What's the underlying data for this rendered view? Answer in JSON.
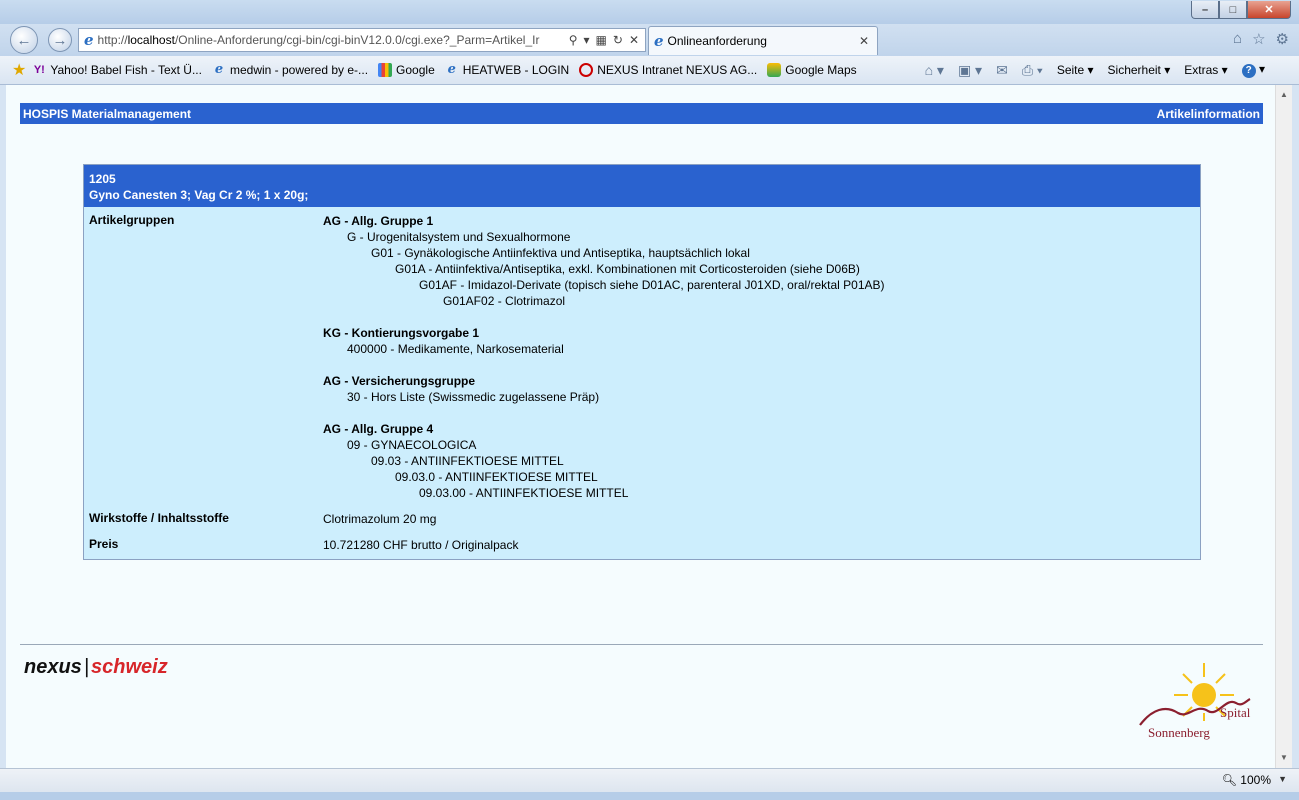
{
  "window": {
    "minimize": "–",
    "maximize": "□",
    "close": "✕"
  },
  "nav": {
    "url_prefix": "http://",
    "url_host": "localhost",
    "url_rest": "/Online-Anforderung/cgi-bin/cgi-binV12.0.0/cgi.exe?_Parm=Artikel_Ir",
    "tab_title": "Onlineanforderung"
  },
  "favorites": [
    "Yahoo! Babel Fish - Text Ü...",
    "medwin - powered by e-...",
    "Google",
    "HEATWEB - LOGIN",
    "NEXUS Intranet NEXUS AG...",
    "Google Maps"
  ],
  "commands": {
    "seite": "Seite",
    "sicherheit": "Sicherheit",
    "extras": "Extras"
  },
  "header": {
    "left": "HOSPIS Materialmanagement",
    "right": "Artikelinformation"
  },
  "article": {
    "number": "1205",
    "name": "Gyno Canesten 3; Vag Cr 2 %; 1 x 20g;",
    "labels": {
      "groups": "Artikelgruppen",
      "substances": "Wirkstoffe / Inhaltsstoffe",
      "price": "Preis"
    },
    "groups": [
      {
        "title": "AG - Allg. Gruppe 1",
        "items": [
          "G - Urogenitalsystem und Sexualhormone",
          "G01 - Gynäkologische Antiinfektiva und Antiseptika, hauptsächlich lokal",
          "G01A - Antiinfektiva/Antiseptika, exkl. Kombinationen mit Corticosteroiden (siehe D06B)",
          "G01AF - Imidazol-Derivate (topisch siehe D01AC, parenteral J01XD, oral/rektal P01AB)",
          "G01AF02 - Clotrimazol"
        ]
      },
      {
        "title": "KG - Kontierungsvorgabe 1",
        "items": [
          "400000 - Medikamente, Narkosematerial"
        ]
      },
      {
        "title": "AG - Versicherungsgruppe",
        "items": [
          "30 - Hors Liste (Swissmedic zugelassene Präp)"
        ]
      },
      {
        "title": "AG - Allg. Gruppe 4",
        "items": [
          "09 - GYNAECOLOGICA",
          "09.03 - ANTIINFEKTIOESE MITTEL",
          "09.03.0 - ANTIINFEKTIOESE MITTEL",
          "09.03.00 - ANTIINFEKTIOESE MITTEL"
        ]
      }
    ],
    "substances": "Clotrimazolum 20 mg",
    "price": "10.721280 CHF brutto / Originalpack"
  },
  "footer": {
    "logo_left_a": "nexus",
    "logo_left_sep": "|",
    "logo_left_b": "schweiz",
    "logo_right_a": "Spital",
    "logo_right_b": "Sonnenberg"
  },
  "status": {
    "zoom": "100%"
  }
}
